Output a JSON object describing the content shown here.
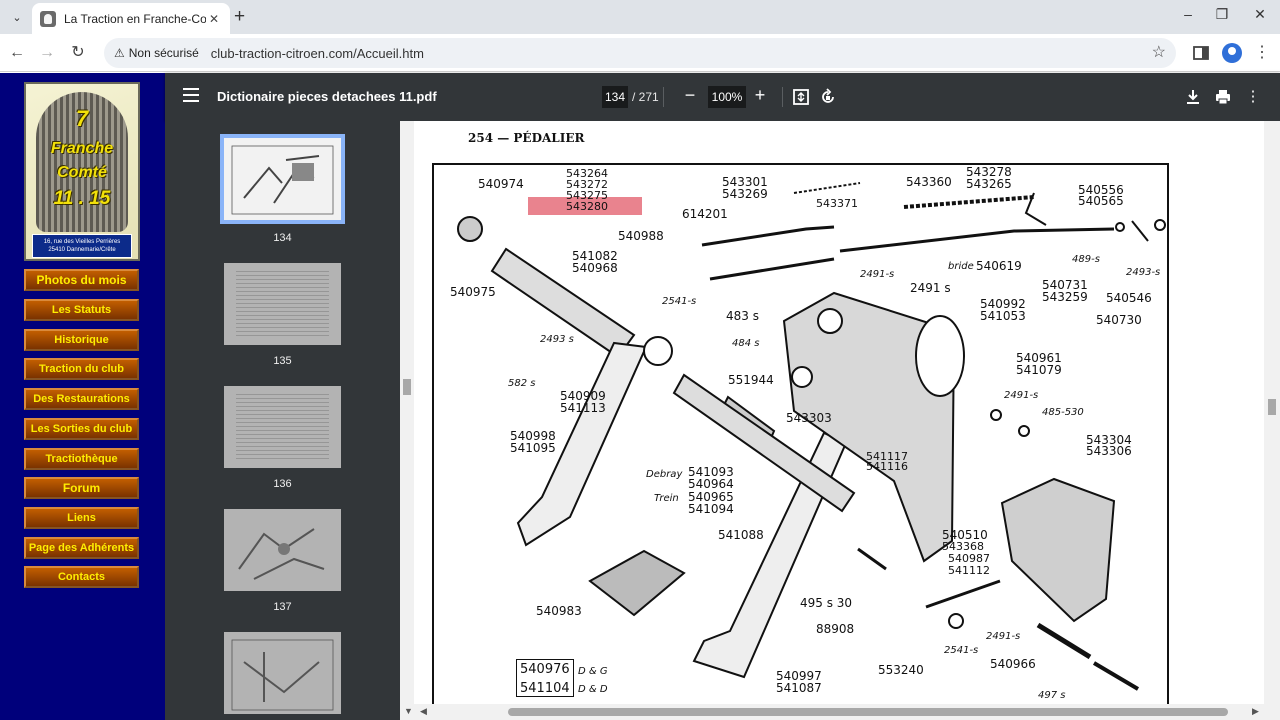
{
  "browser": {
    "tab_title": "La Traction en Franche-Comté",
    "security_label": "Non sécurisé",
    "url": "club-traction-citroen.com/Accueil.htm"
  },
  "site": {
    "logo": {
      "number_top": "7",
      "line1": "Franche",
      "line2": "Comté",
      "numbers": "11 . 15",
      "address_line1": "16, rue des Vieilles Perrières",
      "address_line2": "25410 Dannemarie/Crête"
    },
    "menu": [
      "Photos du mois",
      "Les Statuts",
      "Historique",
      "Traction du club",
      "Des Restaurations",
      "Les Sorties du club",
      "Tractiothèque",
      "Forum",
      "Liens",
      "Page des Adhérents",
      "Contacts"
    ]
  },
  "pdf": {
    "title": "Dictionaire pieces detachees 11.pdf",
    "current_page": "134",
    "total_pages": "/ 271",
    "zoom": "100%",
    "thumbnails": [
      "134",
      "135",
      "136",
      "137"
    ]
  },
  "page_content": {
    "header": "254 — PÉDALIER",
    "parts": [
      "540974",
      "540975",
      "543264",
      "543272",
      "543275",
      "543280",
      "543301",
      "543269",
      "543371",
      "543360",
      "543278",
      "543265",
      "540556",
      "540565",
      "614201",
      "540988",
      "541082",
      "540968",
      "2541-s",
      "2491-s",
      "2491 s",
      "bride",
      "540619",
      "489-s",
      "2493-s",
      "540731",
      "543259",
      "540546",
      "540730",
      "483 s",
      "540992",
      "541053",
      "2493 s",
      "484 s",
      "582 s",
      "540909",
      "541113",
      "551944",
      "540961",
      "541079",
      "2491-s",
      "485-530",
      "543303",
      "540998",
      "541095",
      "543304",
      "543306",
      "541117",
      "541116",
      "Debray",
      "541093",
      "540964",
      "Trein",
      "540965",
      "541094",
      "541088",
      "540510",
      "543368",
      "540987",
      "541112",
      "540983",
      "495 s 30",
      "88908",
      "2491-s",
      "2541-s",
      "540966",
      "553240",
      "540976",
      "541104",
      "D & G",
      "D & D",
      "540997",
      "541087",
      "497 s"
    ]
  }
}
